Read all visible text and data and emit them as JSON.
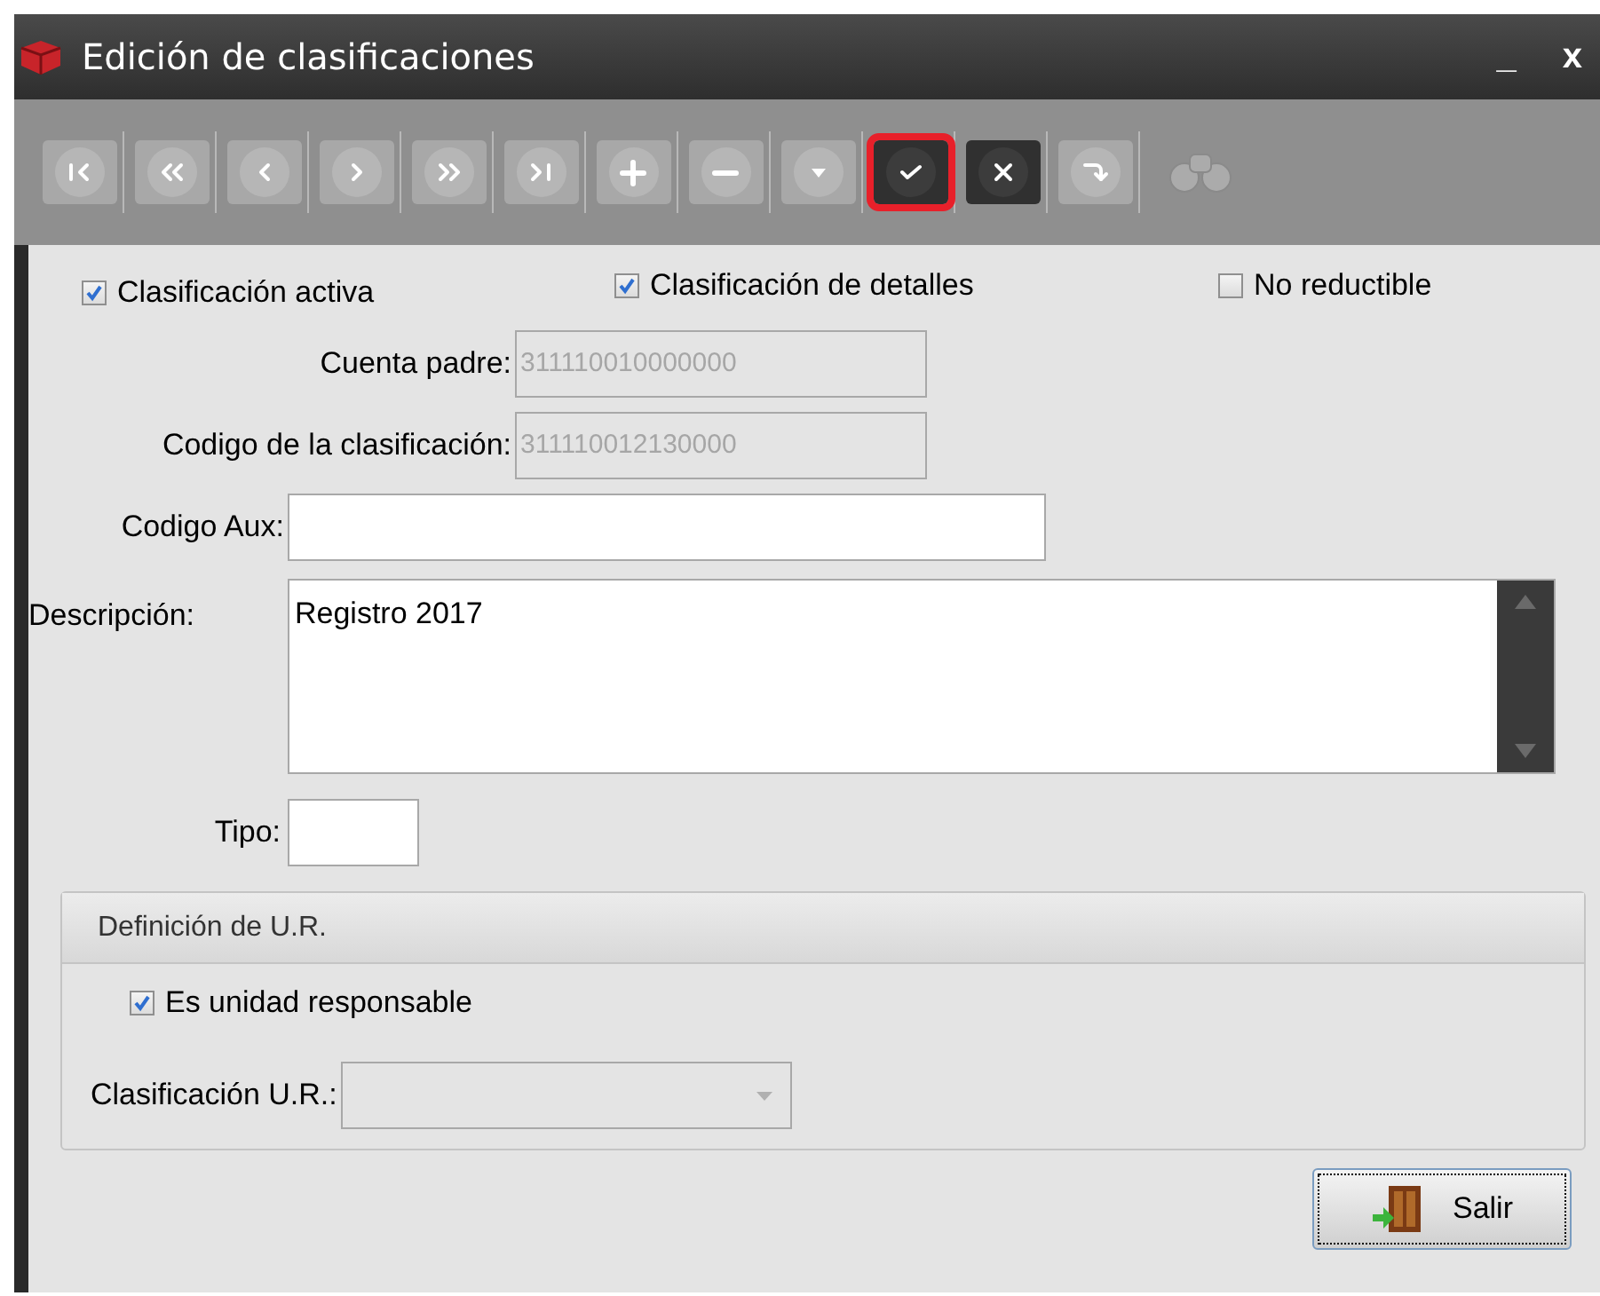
{
  "window": {
    "title": "Edición de clasificaciones",
    "minimize": "_",
    "close": "x"
  },
  "toolbar": [
    {
      "kind": "first",
      "disabled": true,
      "selected": false
    },
    {
      "kind": "prev_page",
      "disabled": true,
      "selected": false
    },
    {
      "kind": "prev",
      "disabled": true,
      "selected": false
    },
    {
      "kind": "next",
      "disabled": true,
      "selected": false
    },
    {
      "kind": "next_page",
      "disabled": true,
      "selected": false
    },
    {
      "kind": "last",
      "disabled": true,
      "selected": false
    },
    {
      "kind": "add",
      "disabled": true,
      "selected": false
    },
    {
      "kind": "remove",
      "disabled": true,
      "selected": false
    },
    {
      "kind": "dropdown",
      "disabled": true,
      "selected": false
    },
    {
      "kind": "accept",
      "disabled": false,
      "selected": true
    },
    {
      "kind": "cancel",
      "disabled": false,
      "selected": false
    },
    {
      "kind": "refresh",
      "disabled": true,
      "selected": false
    },
    {
      "kind": "binoculars",
      "disabled": true,
      "selected": false
    }
  ],
  "checkboxes": [
    {
      "label": "Clasificación activa",
      "checked": true
    },
    {
      "label": "Clasificación de detalles",
      "checked": true
    },
    {
      "label": "No reductible",
      "checked": false
    }
  ],
  "cuenta_padre": {
    "label": "Cuenta padre:",
    "value": "311110010000000"
  },
  "codigo_clasificacion": {
    "label": "Codigo de la clasificación:",
    "value": "311110012130000"
  },
  "codigo_aux": {
    "label": "Codigo Aux:"
  },
  "descripcion": {
    "label": "Descripción:",
    "value": "Registro 2017"
  },
  "tipo": {
    "label": "Tipo:"
  },
  "ur_group": {
    "title": "Definición de U.R.",
    "checkbox": {
      "label": "Es unidad responsable",
      "checked": true
    },
    "clasificacion_ur": {
      "label": "Clasificación U.R.:"
    }
  },
  "buttons": [
    {
      "label": "Salir"
    }
  ]
}
